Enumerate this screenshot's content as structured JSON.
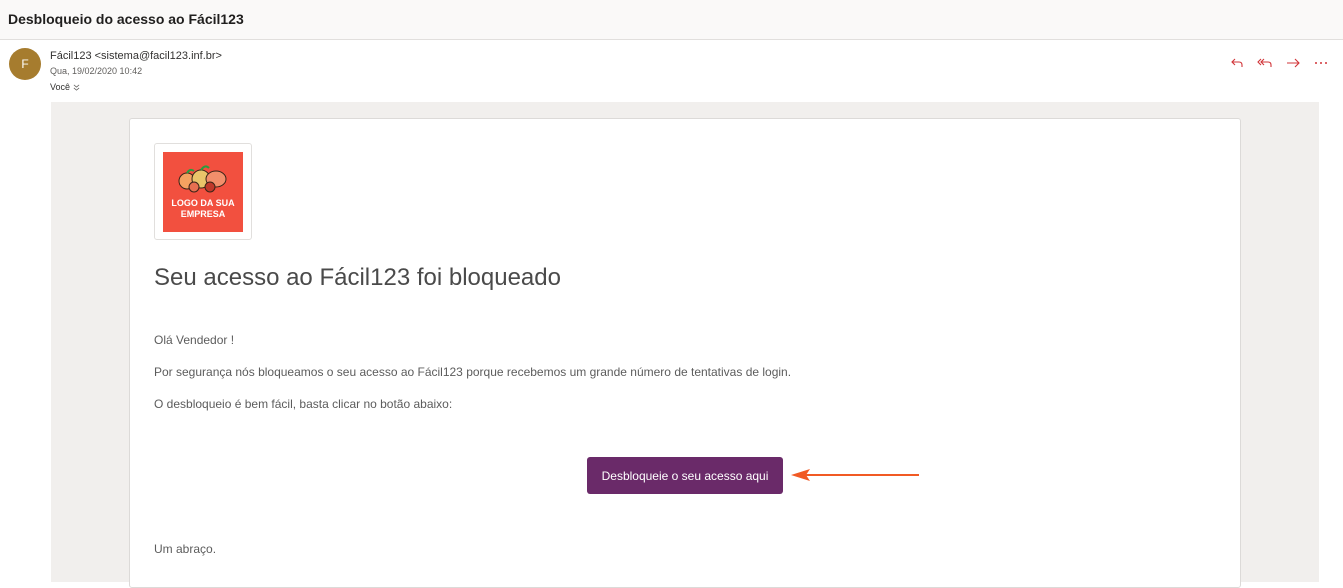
{
  "subject": "Desbloqueio do acesso ao Fácil123",
  "sender": {
    "initial": "F",
    "from": "Fácil123 <sistema@facil123.inf.br>",
    "date": "Qua, 19/02/2020 10:42",
    "to": "Você"
  },
  "email": {
    "logo_text": "LOGO DA SUA EMPRESA",
    "heading": "Seu acesso ao Fácil123 foi bloqueado",
    "greeting": "Olá Vendedor !",
    "body1": "Por segurança nós bloqueamos o seu acesso ao Fácil123 porque recebemos um grande número de tentativas de login.",
    "body2": "O desbloqueio é bem fácil, basta clicar no botão abaixo:",
    "button_label": "Desbloqueie o seu acesso aqui",
    "signoff": "Um abraço."
  },
  "colors": {
    "action_icons": "#d13438",
    "button_bg": "#6a2a69",
    "arrow": "#f15a24",
    "logo_bg": "#f2503f",
    "avatar_bg": "#a67c2e"
  },
  "icons": [
    "reply-icon",
    "reply-all-icon",
    "forward-icon",
    "more-icon"
  ]
}
